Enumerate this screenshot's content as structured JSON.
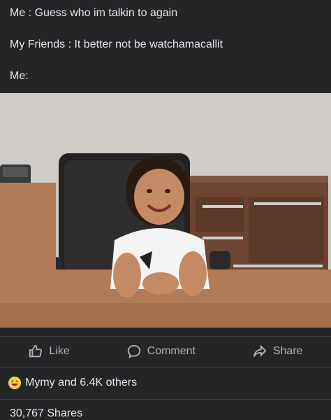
{
  "post": {
    "lines": [
      "Me : Guess who im talkin to again",
      "My Friends : It better not be watchamacallit",
      "Me:"
    ]
  },
  "actions": {
    "like": "Like",
    "comment": "Comment",
    "share": "Share"
  },
  "reactions": {
    "emoji": "laughing-emoji",
    "text": "Mymy and 6.4K others"
  },
  "shares": {
    "text": "30,767 Shares"
  }
}
